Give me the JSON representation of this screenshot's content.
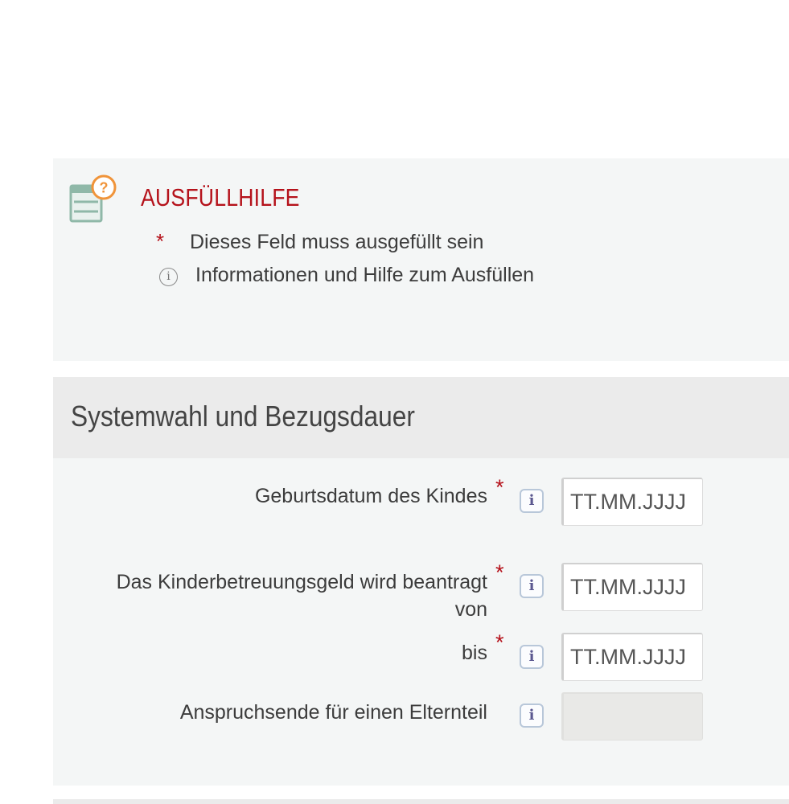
{
  "help": {
    "title": "AUSFÜLLHILFE",
    "required_legend": "Dieses Feld muss ausgefüllt sein",
    "info_legend": "Informationen und Hilfe zum Ausfüllen",
    "required_symbol": "*",
    "info_symbol": "i"
  },
  "section": {
    "title": "Systemwahl und Bezugsdauer",
    "fields": [
      {
        "label": "Geburtsdatum des Kindes",
        "placeholder": "TT.MM.JJJJ",
        "required": true
      },
      {
        "label_line1": "Das Kinderbetreuungsgeld wird beantragt",
        "label_line2": "von",
        "placeholder": "TT.MM.JJJJ",
        "required": true
      },
      {
        "label": "bis",
        "placeholder": "TT.MM.JJJJ",
        "required": true
      },
      {
        "label": "Anspruchsende für einen Elternteil",
        "value": "",
        "required": false,
        "disabled": true
      }
    ],
    "required_symbol": "*",
    "info_symbol": "i"
  },
  "colors": {
    "accent_red": "#b5121b",
    "panel_bg": "#f4f6f6",
    "header_bg": "#ebebeb",
    "icon_orange": "#f0943a",
    "icon_green": "#8fb8a8"
  }
}
